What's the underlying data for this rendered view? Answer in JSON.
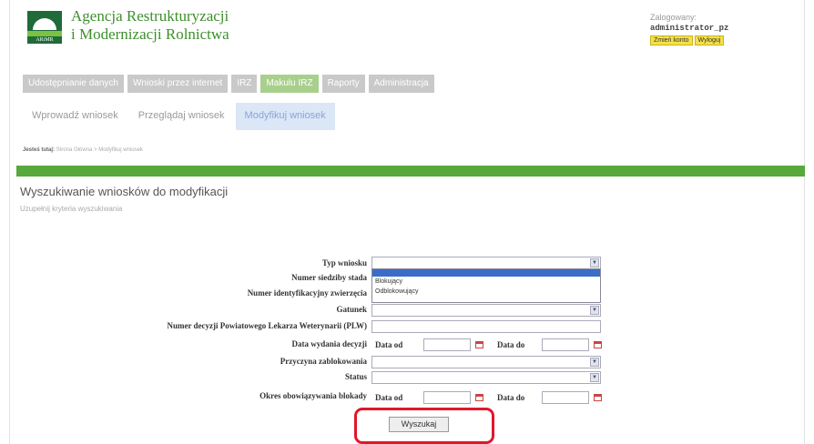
{
  "header": {
    "logo_abbr": "ARiMR",
    "agency_line1": "Agencja Restrukturyzacji",
    "agency_line2": "i Modernizacji Rolnictwa"
  },
  "login": {
    "label": "Zalogowany:",
    "username": "administrator_pz",
    "change_account": "Zmień konto",
    "logout": "Wyloguj"
  },
  "mainnav": [
    {
      "label": "Udostępnianie danych",
      "active": false
    },
    {
      "label": "Wnioski przez internet",
      "active": false
    },
    {
      "label": "IRZ",
      "active": false
    },
    {
      "label": "Makulu IRZ",
      "active": true
    },
    {
      "label": "Raporty",
      "active": false
    },
    {
      "label": "Administracja",
      "active": false
    }
  ],
  "subnav": [
    {
      "label": "Wprowadź wniosek",
      "active": false
    },
    {
      "label": "Przeglądaj wniosek",
      "active": false
    },
    {
      "label": "Modyfikuj wniosek",
      "active": true
    }
  ],
  "breadcrumb": {
    "prefix": "Jesteś tutaj:",
    "path": "Strona Główna > Modyfikuj wniosek"
  },
  "page": {
    "title": "Wyszukiwanie wniosków do modyfikacji",
    "subtitle": "Uzupełnij kryteria wyszukiwania"
  },
  "form": {
    "typ_wniosku": "Typ wniosku",
    "numer_siedziby": "Numer siedziby stada",
    "numer_identyfikacyjny": "Numer identyfikacyjny zwierzęcia",
    "gatunek": "Gatunek",
    "numer_decyzji": "Numer decyzji Powiatowego Lekarza Weterynarii (PLW)",
    "data_wydania": "Data wydania decyzji",
    "przyczyna": "Przyczyna zablokowania",
    "status": "Status",
    "okres": "Okres obowiązywania blokady",
    "data_od": "Data od",
    "data_do": "Data do",
    "dropdown_options": [
      "",
      "Blokujący",
      "Odblokowujący"
    ],
    "search_button": "Wyszukaj"
  }
}
